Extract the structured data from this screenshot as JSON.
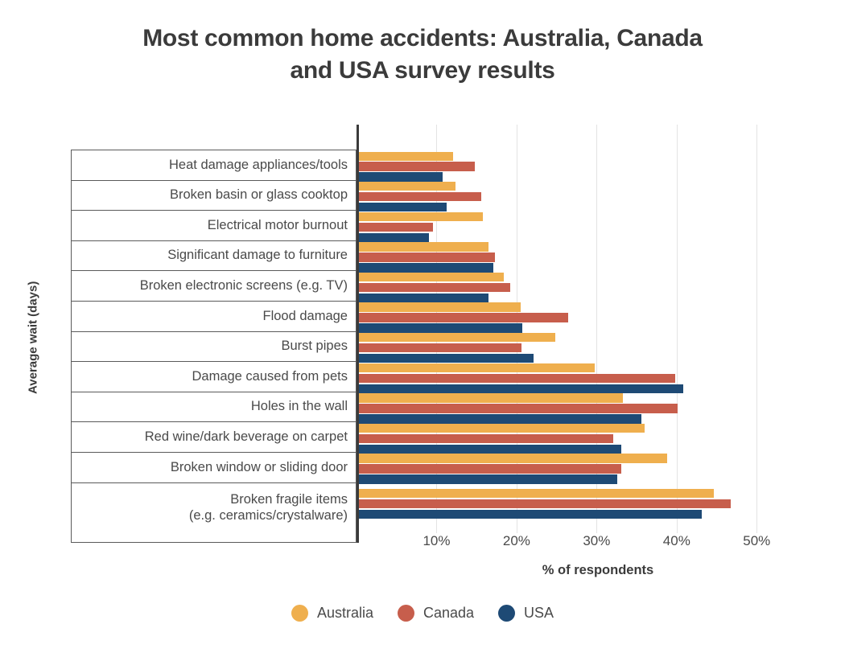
{
  "title": {
    "line1": "Most common home accidents: Australia, Canada",
    "line2": "and USA survey results"
  },
  "axes": {
    "y_title": "Average wait (days)",
    "x_title": "% of respondents"
  },
  "legend": {
    "items": [
      {
        "label": "Australia",
        "color": "#EFAF4E",
        "marker": "circle-swatch"
      },
      {
        "label": "Canada",
        "color": "#C75E4C",
        "marker": "circle-swatch"
      },
      {
        "label": "USA",
        "color": "#1E4A75",
        "marker": "circle-swatch"
      }
    ]
  },
  "chart_data": {
    "type": "bar",
    "orientation": "horizontal",
    "title": "Most common home accidents: Australia, Canada and USA survey results",
    "xlabel": "% of respondents",
    "ylabel": "Average wait (days)",
    "xlim": [
      0,
      55
    ],
    "xticks": [
      10,
      20,
      30,
      40,
      50
    ],
    "xtick_labels": [
      "10%",
      "20%",
      "30%",
      "40%",
      "50%"
    ],
    "grid": "vertical-only",
    "legend_position": "bottom-center",
    "categories": [
      "Heat damage appliances/tools",
      "Broken basin or glass cooktop",
      "Electrical motor burnout",
      "Significant damage to furniture",
      "Broken electronic screens (e.g. TV)",
      "Flood damage",
      "Burst pipes",
      "Damage caused from pets",
      "Holes in the wall",
      "Red wine/dark beverage on carpet",
      "Broken window or sliding door",
      "Broken fragile items (e.g. ceramics/crystalware)"
    ],
    "category_lines": [
      [
        "Heat damage appliances/tools"
      ],
      [
        "Broken basin or glass cooktop"
      ],
      [
        "Electrical motor burnout"
      ],
      [
        "Significant damage to furniture"
      ],
      [
        "Broken electronic screens (e.g. TV)"
      ],
      [
        "Flood damage"
      ],
      [
        "Burst pipes"
      ],
      [
        "Damage caused from pets"
      ],
      [
        "Holes in the wall"
      ],
      [
        "Red wine/dark beverage on carpet"
      ],
      [
        "Broken window or sliding door"
      ],
      [
        "Broken fragile items",
        "(e.g. ceramics/crystalware)"
      ]
    ],
    "series": [
      {
        "name": "Australia",
        "color": "#EFAF4E",
        "values": [
          11.8,
          12.1,
          15.5,
          16.2,
          18.1,
          20.2,
          24.5,
          29.5,
          33.0,
          35.7,
          38.5,
          44.3
        ]
      },
      {
        "name": "Canada",
        "color": "#C75E4C",
        "values": [
          14.5,
          15.3,
          9.3,
          17.0,
          18.9,
          26.1,
          20.3,
          39.5,
          39.8,
          31.8,
          32.8,
          46.5
        ]
      },
      {
        "name": "USA",
        "color": "#1E4A75",
        "values": [
          10.5,
          11.0,
          8.7,
          16.8,
          16.2,
          20.4,
          21.8,
          40.5,
          35.3,
          32.8,
          32.3,
          42.8
        ]
      }
    ]
  }
}
